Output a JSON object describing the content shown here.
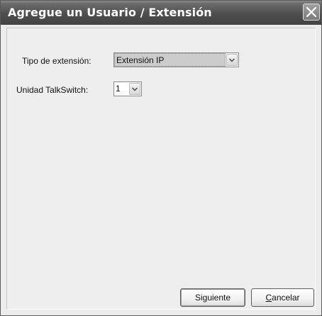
{
  "window": {
    "title": "Agregue un Usuario / Extensión",
    "close_icon": "close-icon"
  },
  "form": {
    "extension_type": {
      "label": "Tipo de extensión:",
      "selected": "Extensión IP"
    },
    "talkswitch_unit": {
      "label": "Unidad TalkSwitch:",
      "selected": "1"
    }
  },
  "buttons": {
    "next_label": "Siguiente",
    "cancel_accel": "C",
    "cancel_rest": "ancelar"
  },
  "icons": {
    "dropdown": "chevron-down-icon",
    "close": "close-icon"
  },
  "colors": {
    "titlebar": "#4e4e4e",
    "client_bg": "#eeeeee",
    "highlight": "#cccccc"
  }
}
